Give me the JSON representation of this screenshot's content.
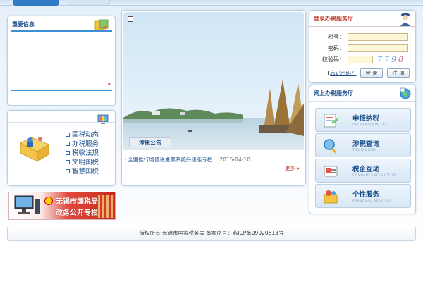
{
  "news_panel": {
    "title": "重要信息"
  },
  "links_panel": {
    "items": [
      {
        "label": "国税动态"
      },
      {
        "label": "办税服务"
      },
      {
        "label": "税收法规"
      },
      {
        "label": "文明国税"
      },
      {
        "label": "智慧国税"
      }
    ]
  },
  "banner": {
    "line1": "无锡市国税局",
    "line2": "政务公开专栏"
  },
  "center": {
    "tab_label": "涉税公告",
    "notices": [
      {
        "title": "全国推行增值税发票系统升级版专栏",
        "date": "2015-04-10"
      }
    ],
    "more": "更多 ▸"
  },
  "login": {
    "title": "登录办税服务厅",
    "tax_id_label": "税号：",
    "password_label": "密码：",
    "captcha_label": "校验码：",
    "captcha_value": "7798",
    "remember_label": "忘记密码？",
    "login_button": "登 录",
    "register_button": "注 册"
  },
  "services": {
    "title": "网上办税服务厅",
    "items": [
      {
        "cn": "申报纳税",
        "en": "DECLARATION TAX",
        "icon": "declaration-icon"
      },
      {
        "cn": "涉税查询",
        "en": "TAX INQUIRY",
        "icon": "inquiry-icon"
      },
      {
        "cn": "税企互动",
        "en": "COMPANY INTERACTIVE",
        "icon": "interaction-icon"
      },
      {
        "cn": "个性服务",
        "en": "PERSONAL SERVICES",
        "icon": "personal-service-icon"
      }
    ]
  },
  "footer": {
    "text": "版权所有 无锡市国家税务局 备案序号：苏ICP备09020813号"
  },
  "colors": {
    "accent": "#1a4f8b",
    "login_title": "#c0392b",
    "banner_red": "#c62a1d"
  }
}
